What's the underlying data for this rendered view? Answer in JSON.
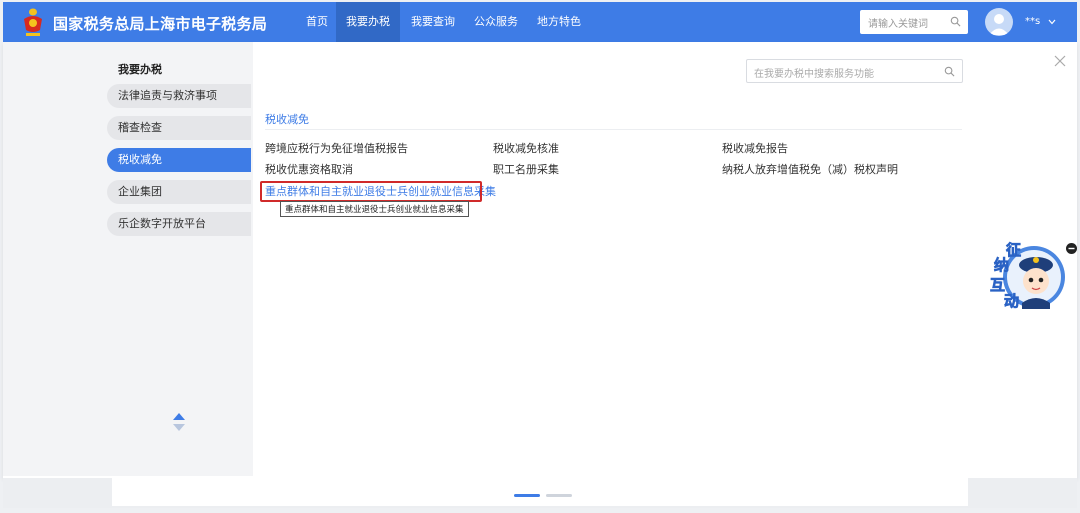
{
  "header": {
    "site_title": "国家税务总局上海市电子税务局",
    "nav": [
      {
        "label": "首页",
        "active": false
      },
      {
        "label": "我要办税",
        "active": true
      },
      {
        "label": "我要查询",
        "active": false
      },
      {
        "label": "公众服务",
        "active": false
      },
      {
        "label": "地方特色",
        "active": false
      }
    ],
    "search_placeholder": "请输入关键词",
    "username": "**s"
  },
  "sidebar": {
    "title": "我要办税",
    "items": [
      {
        "label": "法律追责与救济事项",
        "active": false
      },
      {
        "label": "稽查检查",
        "active": false
      },
      {
        "label": "税收减免",
        "active": true
      },
      {
        "label": "企业集团",
        "active": false
      },
      {
        "label": "乐企数字开放平台",
        "active": false
      }
    ]
  },
  "content": {
    "search_placeholder": "在我要办税中搜索服务功能",
    "category": "税收减免",
    "services": [
      "跨境应税行为免征增值税报告",
      "税收减免核准",
      "税收减免报告",
      "税收优惠资格取消",
      "职工名册采集",
      "纳税人放弃增值税免（减）税权声明",
      "重点群体和自主就业退役士兵创业就业信息采集"
    ],
    "tooltip": "重点群体和自主就业退役士兵创业就业信息采集"
  },
  "mascot": {
    "label_chars": [
      "纳",
      "征",
      "互",
      "动"
    ]
  },
  "colors": {
    "primary": "#3e7ce6",
    "nav_active": "#3169c6",
    "highlight_border": "#d02a2a"
  }
}
